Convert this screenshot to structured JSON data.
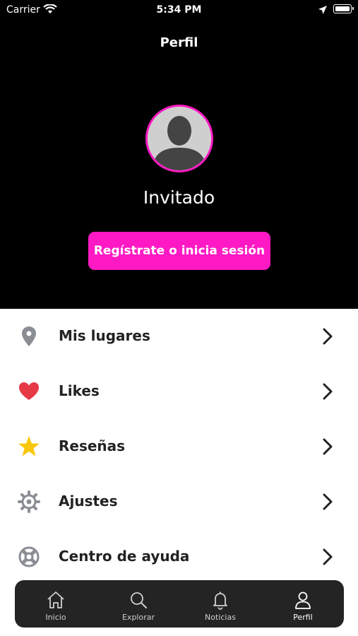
{
  "status_bar": {
    "carrier": "Carrier",
    "time": "5:34 PM"
  },
  "header": {
    "title": "Perfil"
  },
  "profile": {
    "name": "Invitado",
    "cta_label": "Regístrate o inicia sesión",
    "accent_color": "#ff19c4"
  },
  "menu": {
    "items": [
      {
        "label": "Mis lugares",
        "icon": "location-pin-icon"
      },
      {
        "label": "Likes",
        "icon": "heart-icon"
      },
      {
        "label": "Reseñas",
        "icon": "star-icon"
      },
      {
        "label": "Ajustes",
        "icon": "gear-icon"
      },
      {
        "label": "Centro de ayuda",
        "icon": "lifebuoy-icon"
      }
    ]
  },
  "tabbar": {
    "tabs": [
      {
        "label": "Inicio",
        "icon": "home-icon"
      },
      {
        "label": "Explorar",
        "icon": "search-icon"
      },
      {
        "label": "Noticias",
        "icon": "bell-icon"
      },
      {
        "label": "Perfil",
        "icon": "user-icon"
      }
    ],
    "active": "Perfil"
  }
}
